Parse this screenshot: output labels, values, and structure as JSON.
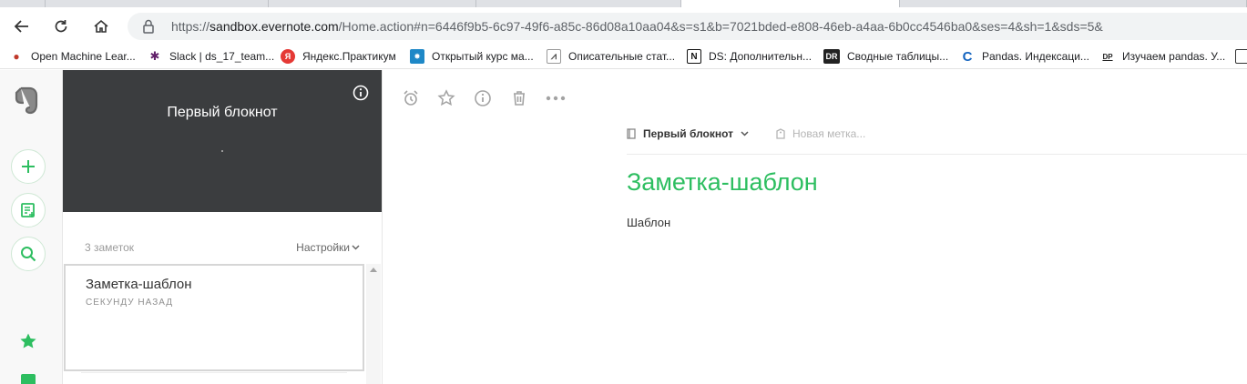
{
  "browser": {
    "url_prefix": "https://",
    "url_host": "sandbox.evernote.com",
    "url_path": "/Home.action#n=6446f9b5-6c97-49f6-a85c-86d08a10aa04&s=s1&b=7021bded-e808-46eb-a4aa-6b0cc4546ba0&ses=4&sh=1&sds=5&"
  },
  "bookmarks": [
    {
      "label": "Open Machine Lear...",
      "icon": "ods-icon",
      "color": "#c0392b"
    },
    {
      "label": "Slack | ds_17_team...",
      "icon": "slack-icon",
      "color": "#611f69"
    },
    {
      "label": "Яндекс.Практикум",
      "icon": "yandex-icon",
      "color": "#e53935"
    },
    {
      "label": "Открытый курс ма...",
      "icon": "ods-course-icon",
      "color": "#1e88c7"
    },
    {
      "label": "Описательные стат...",
      "icon": "stats-icon",
      "color": "#555555"
    },
    {
      "label": "DS: Дополнительн...",
      "icon": "notion-icon",
      "color": "#111111"
    },
    {
      "label": "Сводные таблицы...",
      "icon": "dr-icon",
      "color": "#222222"
    },
    {
      "label": "Pandas. Индексаци...",
      "icon": "c-icon",
      "color": "#1565c0"
    },
    {
      "label": "Изучаем pandas. У...",
      "icon": "dp-icon",
      "color": "#222222"
    }
  ],
  "notebook": {
    "title": "Первый блокнот",
    "notes_count": "3 заметок",
    "settings_label": "Настройки"
  },
  "notes": [
    {
      "title": "Заметка-шаблон",
      "time": "СЕКУНДУ НАЗАД"
    }
  ],
  "editor": {
    "notebook_label": "Первый блокнот",
    "tag_placeholder": "Новая метка...",
    "title": "Заметка-шаблон",
    "body": "Шаблон"
  },
  "colors": {
    "accent": "#2dbe60",
    "header_bg": "#3b3d3f"
  }
}
